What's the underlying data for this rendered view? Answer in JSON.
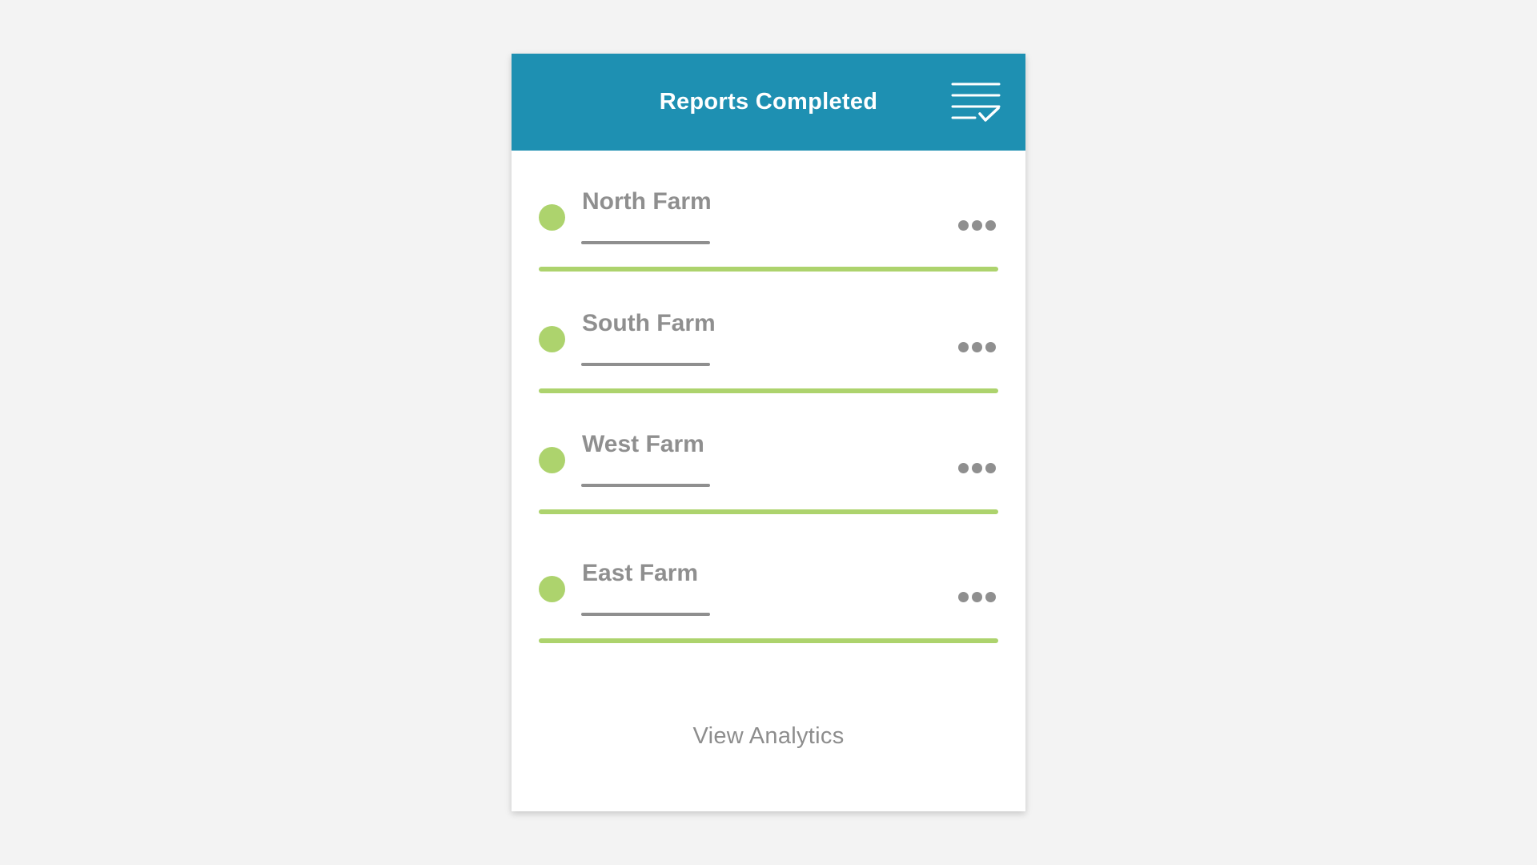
{
  "header": {
    "title": "Reports Completed",
    "icon": "list-check-icon",
    "color": "#1e90b2"
  },
  "items": [
    {
      "label": "North Farm",
      "status": "complete",
      "icon": "status-dot-icon",
      "menu_icon": "more-horizontal-icon"
    },
    {
      "label": "South Farm",
      "status": "complete",
      "icon": "status-dot-icon",
      "menu_icon": "more-horizontal-icon"
    },
    {
      "label": "West Farm",
      "status": "complete",
      "icon": "status-dot-icon",
      "menu_icon": "more-horizontal-icon"
    },
    {
      "label": "East Farm",
      "status": "complete",
      "icon": "status-dot-icon",
      "menu_icon": "more-horizontal-icon"
    }
  ],
  "footer": {
    "link_label": "View Analytics"
  },
  "colors": {
    "status_green": "#add36d",
    "text_gray": "#8f8f8f",
    "background": "#f3f3f3",
    "card": "#ffffff"
  }
}
